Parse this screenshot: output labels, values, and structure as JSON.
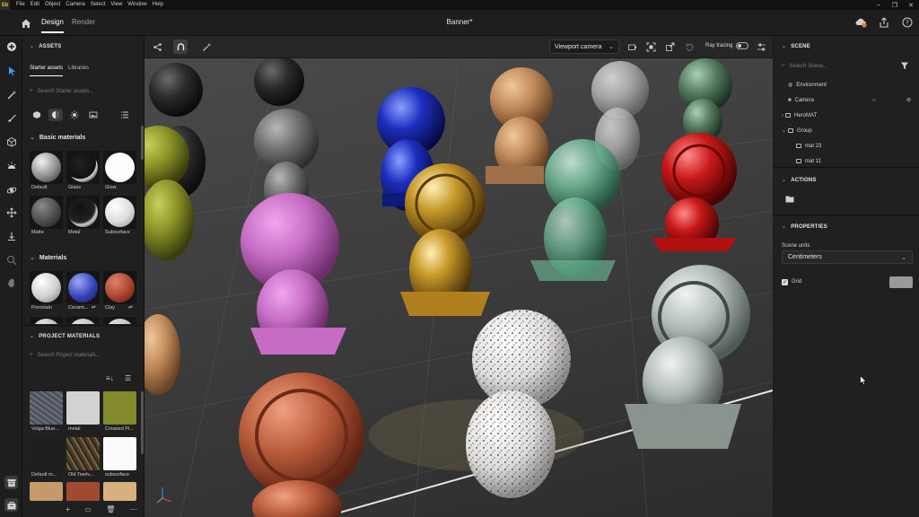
{
  "menubar": {
    "logo": "Sb",
    "items": [
      "File",
      "Edit",
      "Object",
      "Camera",
      "Select",
      "View",
      "Window",
      "Help"
    ],
    "window_controls": [
      "–",
      "❐",
      "✕"
    ]
  },
  "titlebar": {
    "tabs": [
      "Design",
      "Render"
    ],
    "active_tab": "Design",
    "document_title": "Banner*"
  },
  "assets": {
    "header": "ASSETS",
    "subtabs": [
      "Starter assets",
      "Libraries"
    ],
    "search_placeholder": "Search Starter assets...",
    "basic_section": "Basic materials",
    "basic_materials": [
      {
        "label": "Default"
      },
      {
        "label": "Glass"
      },
      {
        "label": "Glow"
      },
      {
        "label": "Matte"
      },
      {
        "label": "Metal"
      },
      {
        "label": "Subsurface"
      }
    ],
    "materials_section": "Materials",
    "materials": [
      {
        "label": "Porcelain"
      },
      {
        "label": "Cerami..."
      },
      {
        "label": "Clay"
      }
    ],
    "project_header": "PROJECT MATERIALS",
    "project_search_placeholder": "Search Project materials...",
    "project_materials": [
      {
        "label": "Volga Blue..."
      },
      {
        "label": "metal"
      },
      {
        "label": "Creased Pl..."
      },
      {
        "label": "Default m..."
      },
      {
        "label": "Old Twelv..."
      },
      {
        "label": "subsurface"
      }
    ]
  },
  "viewport_toolbar": {
    "camera": "Viewport camera",
    "ray_tracing_label": "Ray tracing",
    "ray_tracing_on": false
  },
  "scene": {
    "header": "SCENE",
    "search_placeholder": "Search Scene...",
    "items": [
      {
        "label": "Environment"
      },
      {
        "label": "Camera"
      },
      {
        "label": "HeroMAT"
      },
      {
        "label": "Group"
      },
      {
        "label": "mat 23"
      },
      {
        "label": "mat 11"
      }
    ],
    "actions_header": "ACTIONS",
    "properties_header": "PROPERTIES",
    "units_label": "Scene units",
    "units_value": "Centimeters",
    "grid_label": "Grid",
    "grid_checked": true
  },
  "colors": {
    "accent": "#e8c32a",
    "panel_bg": "#202020",
    "grid_swatch": "#9a9a9a"
  }
}
